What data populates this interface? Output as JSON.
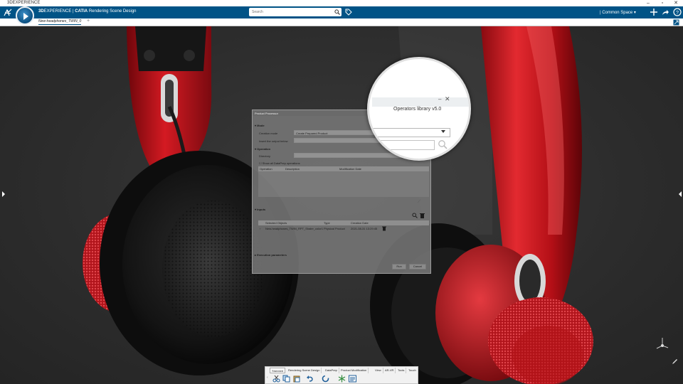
{
  "window": {
    "app_name": "3DEXPERIENCE"
  },
  "header": {
    "brand_prefix": "3D",
    "brand_mid": "EXPERIENCE | ",
    "brand_app": "CATIA",
    "app_title": "Rendering Scene Design",
    "search_placeholder": "Search",
    "space_label": "| Common Space",
    "icons": [
      "3ds-logo-icon",
      "compass-icon",
      "search-icon",
      "tag-icon",
      "add-icon",
      "share-icon",
      "help-icon",
      "fullscreen-icon"
    ]
  },
  "tabs": {
    "document": "New-headphones_TWIN_0",
    "add": "+"
  },
  "dialog": {
    "title": "Product Processor",
    "mode_section": "Mode",
    "creation_mode_label": "Creation mode",
    "creation_mode_value": "Create Prepared Product",
    "insert_label": "Insert the output below",
    "operation_section": "Operation",
    "directory_label": "Directory",
    "show_all_label": "Show all DataPrep operations",
    "op_columns": [
      "Operation",
      "Description",
      "Modification Date"
    ],
    "inputs_section": "Inputs",
    "input_columns": [
      "Selected Objects",
      "Type",
      "Creation Date"
    ],
    "input_row": {
      "name": "New-headphones_TWIN_RPT_Shaler_color1",
      "type": "Physical Product",
      "date": "2021-08-31 13:29:45"
    },
    "execution_section": "Execution parameters",
    "run_button": "Run",
    "cancel_button": "Cancel"
  },
  "magnifier": {
    "title": "Operators library v5.0",
    "min_glyph": "–",
    "close_glyph": "✕"
  },
  "toolbar": {
    "tabs": [
      "Standard",
      "Rendering Scene Design",
      "DataPrep",
      "Product Modification",
      "View",
      "AR-VR",
      "Tools",
      "Touch"
    ],
    "active_tab": "Standard",
    "tools": [
      "cut-icon",
      "copy-icon",
      "paste-icon",
      "undo-icon",
      "update-icon",
      "snowflake-icon",
      "properties-icon"
    ]
  },
  "colors": {
    "header_blue": "#005386",
    "product_red": "#c8121a",
    "cushion_black": "#121212"
  }
}
